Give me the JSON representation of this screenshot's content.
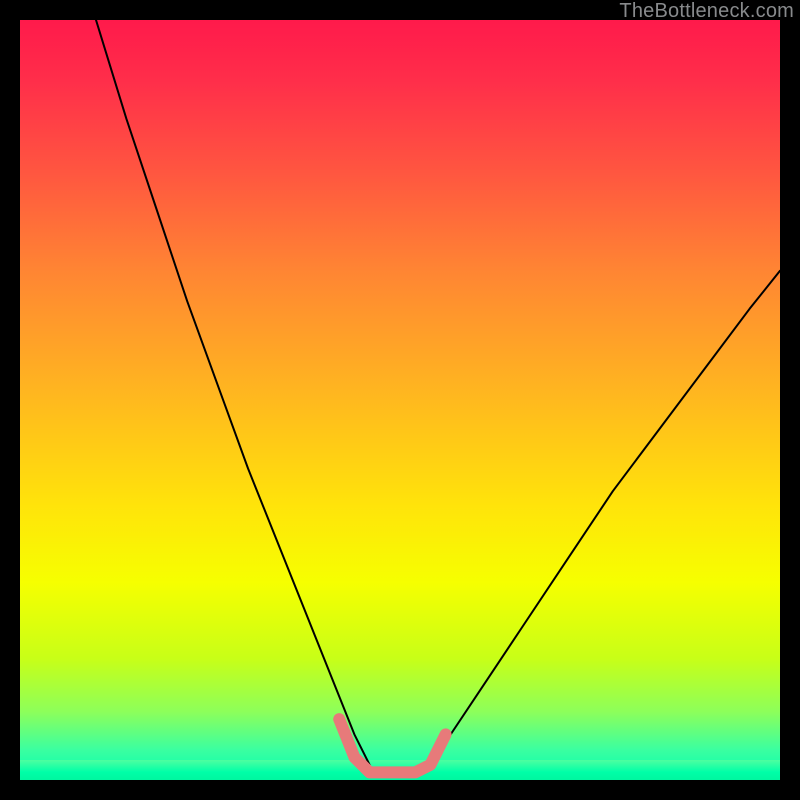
{
  "watermark": "TheBottleneck.com",
  "chart_data": {
    "type": "line",
    "title": "",
    "xlabel": "",
    "ylabel": "",
    "xlim": [
      0,
      100
    ],
    "ylim": [
      0,
      100
    ],
    "grid": false,
    "legend": false,
    "series": [
      {
        "name": "curve-left-branch",
        "stroke": "#000000",
        "weight": 2,
        "x": [
          10,
          14,
          18,
          22,
          26,
          30,
          34,
          38,
          42,
          44,
          46
        ],
        "y": [
          100,
          87,
          75,
          63,
          52,
          41,
          31,
          21,
          11,
          6,
          2
        ]
      },
      {
        "name": "curve-right-branch",
        "stroke": "#000000",
        "weight": 2,
        "x": [
          54,
          56,
          60,
          66,
          72,
          78,
          84,
          90,
          96,
          100
        ],
        "y": [
          2,
          5,
          11,
          20,
          29,
          38,
          46,
          54,
          62,
          67
        ]
      },
      {
        "name": "valley-pink-highlight",
        "stroke": "#e77a7a",
        "weight": 12,
        "x": [
          42,
          44,
          46,
          48,
          50,
          52,
          54,
          56
        ],
        "y": [
          8,
          3,
          1,
          1,
          1,
          1,
          2,
          6
        ]
      }
    ],
    "gradient_stops": [
      {
        "pos": 0.0,
        "color": "#ff1a4b"
      },
      {
        "pos": 0.08,
        "color": "#ff2e4a"
      },
      {
        "pos": 0.2,
        "color": "#ff5640"
      },
      {
        "pos": 0.33,
        "color": "#ff8533"
      },
      {
        "pos": 0.48,
        "color": "#ffb321"
      },
      {
        "pos": 0.64,
        "color": "#ffe40a"
      },
      {
        "pos": 0.74,
        "color": "#f6ff00"
      },
      {
        "pos": 0.84,
        "color": "#c8ff17"
      },
      {
        "pos": 0.91,
        "color": "#8dff5a"
      },
      {
        "pos": 0.96,
        "color": "#3bffa0"
      },
      {
        "pos": 1.0,
        "color": "#00ffb0"
      }
    ]
  }
}
